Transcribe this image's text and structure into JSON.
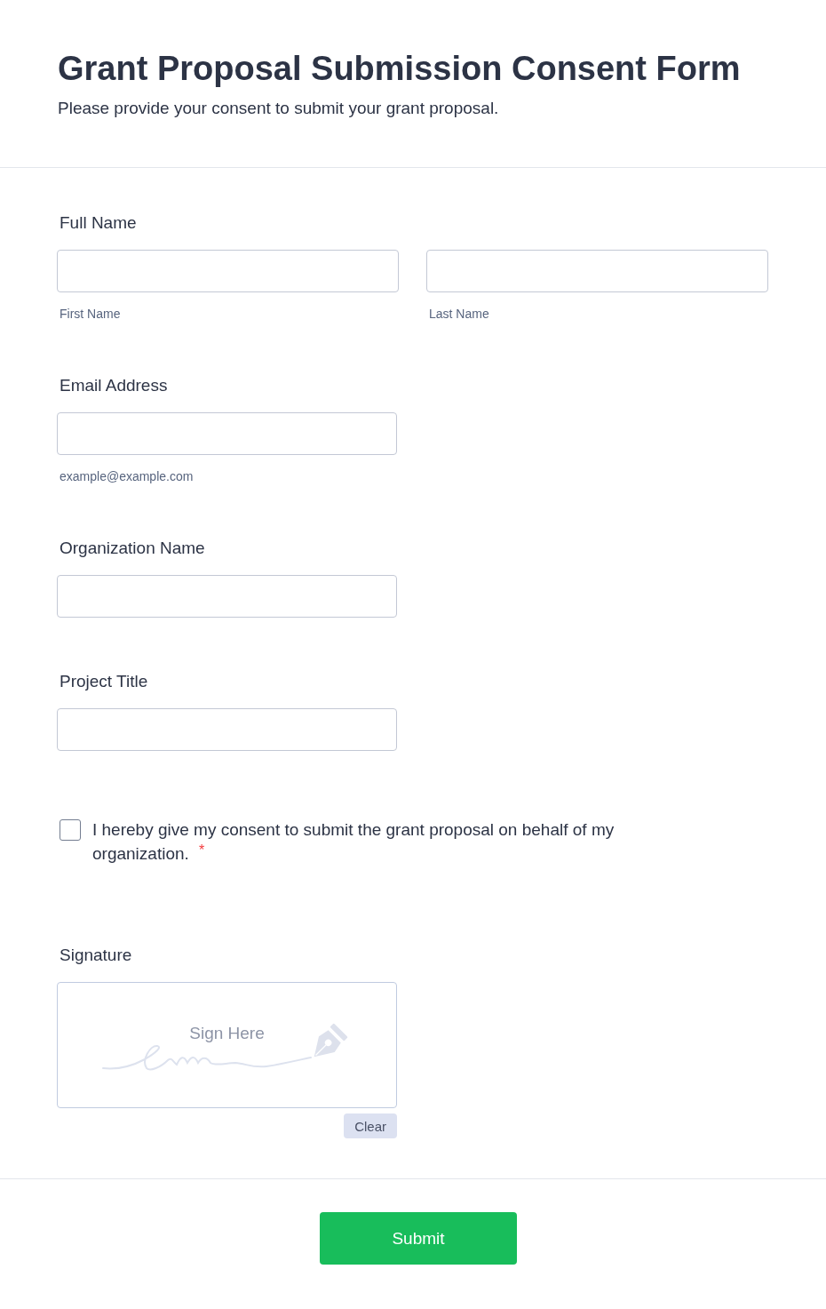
{
  "header": {
    "title": "Grant Proposal Submission Consent Form",
    "subtitle": "Please provide your consent to submit your grant proposal."
  },
  "fields": [
    {
      "kind": "split",
      "label": "Full Name",
      "inputs": [
        {
          "sublabel": "First Name"
        },
        {
          "sublabel": "Last Name"
        }
      ]
    },
    {
      "kind": "text",
      "label": "Email Address",
      "sublabel": "example@example.com"
    },
    {
      "kind": "text",
      "label": "Organization Name"
    },
    {
      "kind": "text",
      "label": "Project Title"
    },
    {
      "kind": "checkbox",
      "text": "I hereby give my consent to submit the grant proposal on behalf of my organization. $^{*}$",
      "checked": false
    },
    {
      "kind": "signature",
      "label": "Signature",
      "placeholder": "Sign Here",
      "button": "Clear"
    }
  ],
  "submit": {
    "label": "Submit"
  }
}
